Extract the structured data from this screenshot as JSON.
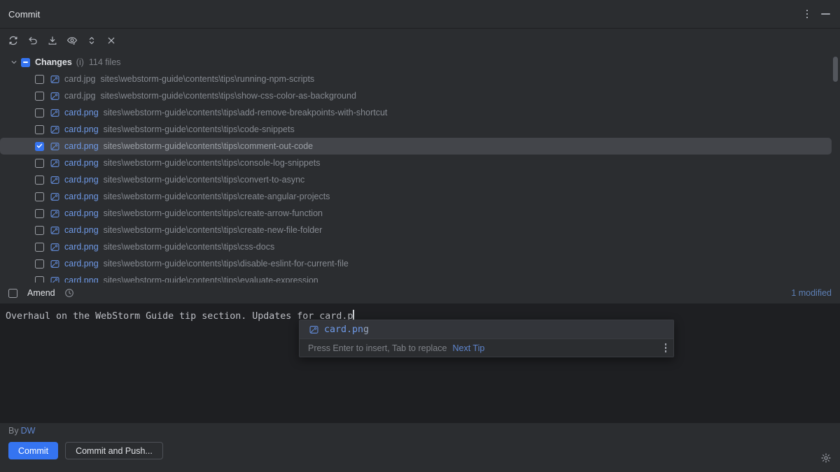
{
  "window": {
    "title": "Commit",
    "more_options_icon": "vertical-dots-icon",
    "minimize_icon": "minimize-icon"
  },
  "toolbar": {
    "items": [
      {
        "icon": "refresh-changes-icon",
        "label": "Refresh Changes"
      },
      {
        "icon": "rollback-icon",
        "label": "Rollback"
      },
      {
        "icon": "update-project-icon",
        "label": "Update Project"
      },
      {
        "icon": "show-diff-icon",
        "label": "Show Diff"
      },
      {
        "icon": "expand-collapse-icon",
        "label": "Expand / Collapse"
      },
      {
        "icon": "close-icon",
        "label": "Close"
      }
    ]
  },
  "changes": {
    "chevron_icon": "chevron-down-icon",
    "checkbox_state": "partial",
    "label": "Changes",
    "info": "(i)",
    "count": "114 files",
    "files": [
      {
        "checked": false,
        "icon": "image-file-icon",
        "name": "card.jpg",
        "path": "sites\\webstorm-guide\\contents\\tips\\running-npm-scripts",
        "state": "muted",
        "selected": false
      },
      {
        "checked": false,
        "icon": "image-file-icon",
        "name": "card.jpg",
        "path": "sites\\webstorm-guide\\contents\\tips\\show-css-color-as-background",
        "state": "muted",
        "selected": false
      },
      {
        "checked": false,
        "icon": "image-file-icon",
        "name": "card.png",
        "path": "sites\\webstorm-guide\\contents\\tips\\add-remove-breakpoints-with-shortcut",
        "state": "active",
        "selected": false
      },
      {
        "checked": false,
        "icon": "image-file-icon",
        "name": "card.png",
        "path": "sites\\webstorm-guide\\contents\\tips\\code-snippets",
        "state": "active",
        "selected": false
      },
      {
        "checked": true,
        "icon": "image-file-icon",
        "name": "card.png",
        "path": "sites\\webstorm-guide\\contents\\tips\\comment-out-code",
        "state": "active",
        "selected": true
      },
      {
        "checked": false,
        "icon": "image-file-icon",
        "name": "card.png",
        "path": "sites\\webstorm-guide\\contents\\tips\\console-log-snippets",
        "state": "active",
        "selected": false
      },
      {
        "checked": false,
        "icon": "image-file-icon",
        "name": "card.png",
        "path": "sites\\webstorm-guide\\contents\\tips\\convert-to-async",
        "state": "active",
        "selected": false
      },
      {
        "checked": false,
        "icon": "image-file-icon",
        "name": "card.png",
        "path": "sites\\webstorm-guide\\contents\\tips\\create-angular-projects",
        "state": "active",
        "selected": false
      },
      {
        "checked": false,
        "icon": "image-file-icon",
        "name": "card.png",
        "path": "sites\\webstorm-guide\\contents\\tips\\create-arrow-function",
        "state": "active",
        "selected": false
      },
      {
        "checked": false,
        "icon": "image-file-icon",
        "name": "card.png",
        "path": "sites\\webstorm-guide\\contents\\tips\\create-new-file-folder",
        "state": "active",
        "selected": false
      },
      {
        "checked": false,
        "icon": "image-file-icon",
        "name": "card.png",
        "path": "sites\\webstorm-guide\\contents\\tips\\css-docs",
        "state": "active",
        "selected": false
      },
      {
        "checked": false,
        "icon": "image-file-icon",
        "name": "card.png",
        "path": "sites\\webstorm-guide\\contents\\tips\\disable-eslint-for-current-file",
        "state": "active",
        "selected": false
      },
      {
        "checked": false,
        "icon": "image-file-icon",
        "name": "card.png",
        "path": "sites\\webstorm-guide\\contents\\tips\\evaluate-expression",
        "state": "active",
        "selected": false
      }
    ]
  },
  "amend": {
    "checked": false,
    "label": "Amend",
    "history_icon": "clock-icon",
    "modified_count": "1 modified"
  },
  "editor": {
    "message": "Overhaul on the WebStorm Guide tip section. Updates for card.p",
    "caret_visible": true
  },
  "completion_popup": {
    "item_icon": "image-file-icon",
    "item_prefix": "card.pn",
    "item_suffix": "g",
    "hint": "Press Enter to insert, Tab to replace",
    "link": "Next Tip",
    "menu_icon": "vertical-dots-icon"
  },
  "footer": {
    "by_label": "By",
    "author": "DW",
    "commit_label": "Commit",
    "commit_push_label": "Commit and Push...",
    "settings_icon": "gear-icon"
  },
  "colors": {
    "background": "#2b2d30",
    "editor_background": "#1e1f22",
    "accent": "#3574f0",
    "link": "#5f86cf",
    "file_active": "#6f9ae8",
    "muted": "#868a91",
    "selection": "#43454a"
  }
}
